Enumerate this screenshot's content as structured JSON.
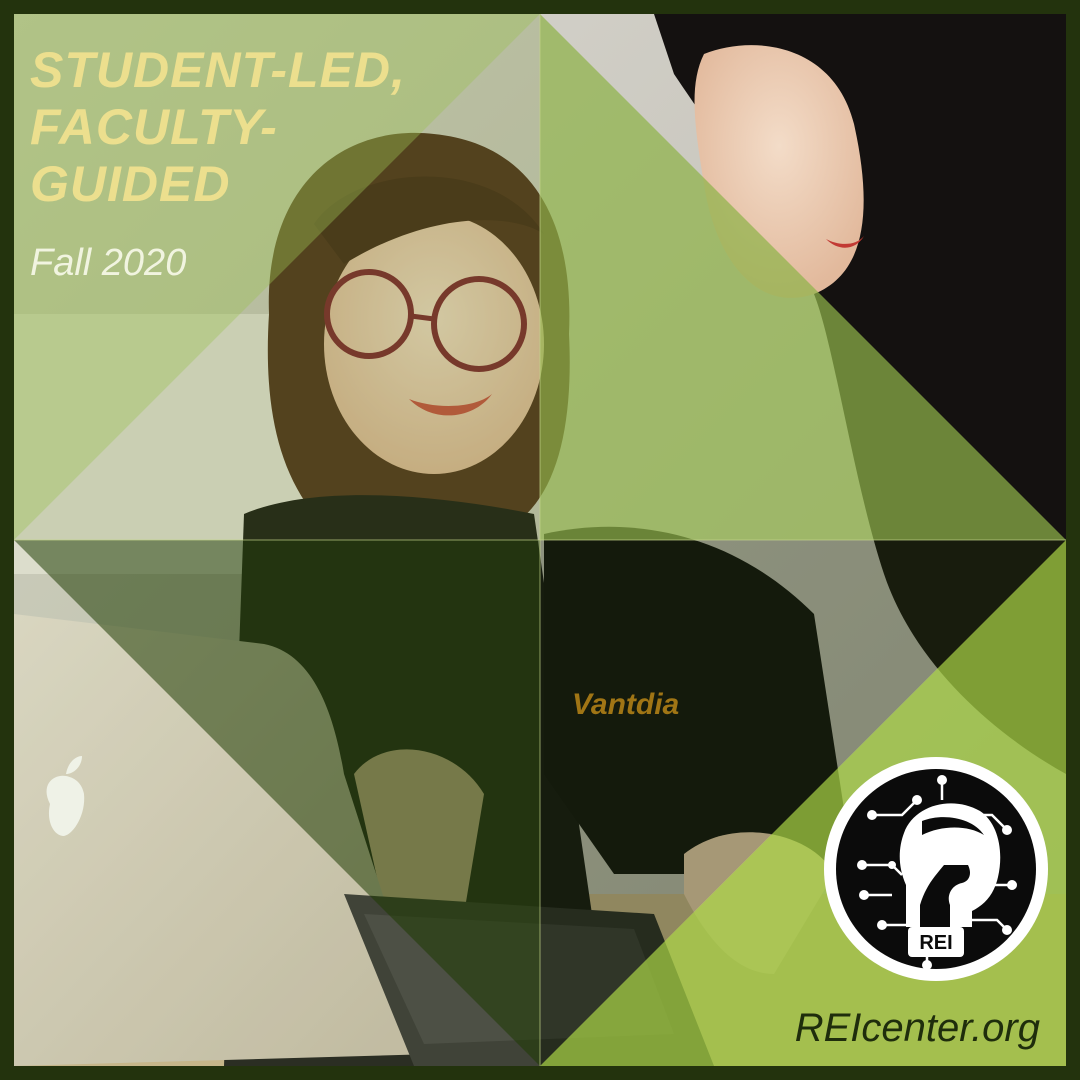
{
  "headline": {
    "line1": "STUDENT-LED,",
    "line2": "FACULTY-",
    "line3": "GUIDED"
  },
  "subtitle": "Fall 2020",
  "website": "REIcenter.org",
  "logo": {
    "text": "REI",
    "icon": "spartan-helmet-icon"
  },
  "shirt_text": "Vantdia",
  "colors": {
    "border": "#23330d",
    "headline": "#ecdf8e",
    "overlay_light": "#8fb34a",
    "overlay_dark": "#2f4a10"
  }
}
